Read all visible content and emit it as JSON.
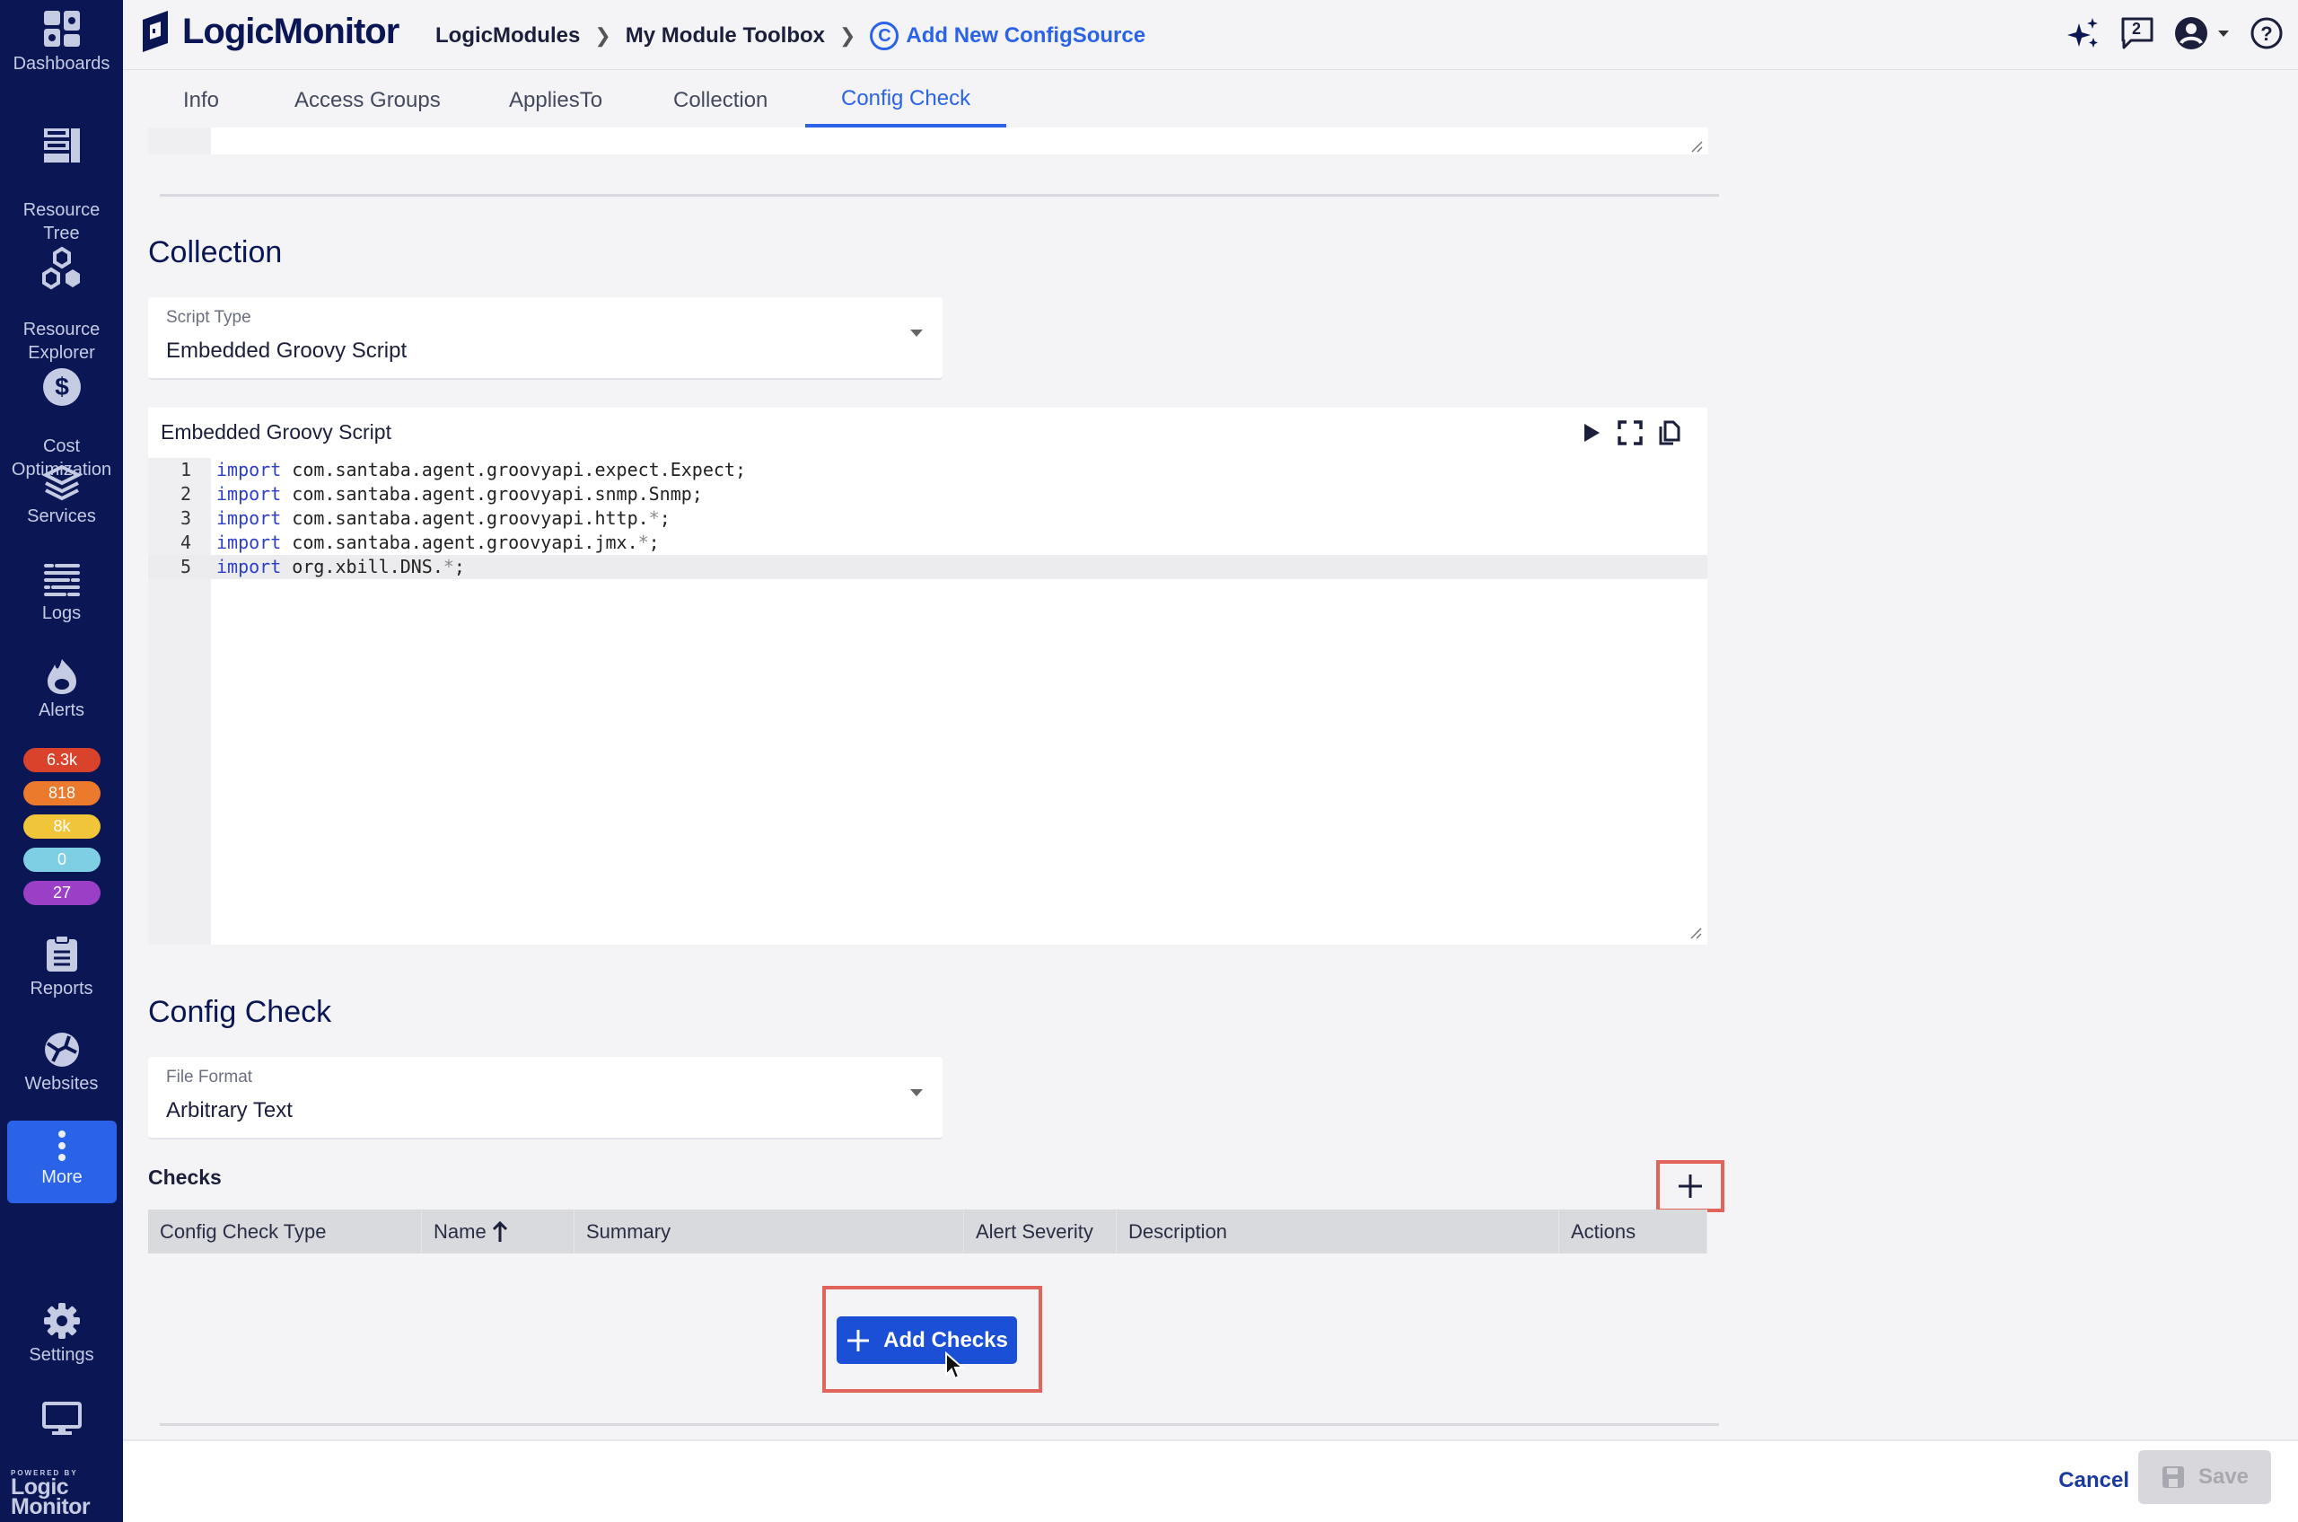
{
  "sidebar": {
    "items": [
      {
        "label": "Dashboards",
        "icon": "dashboards-icon"
      },
      {
        "label": "Resource\nTree",
        "icon": "resource-tree-icon"
      },
      {
        "label": "Resource\nExplorer",
        "icon": "resource-explorer-icon"
      },
      {
        "label": "Cost\nOptimization",
        "icon": "cost-icon"
      },
      {
        "label": "Services",
        "icon": "services-icon"
      },
      {
        "label": "Logs",
        "icon": "logs-icon"
      },
      {
        "label": "Alerts",
        "icon": "alerts-icon"
      },
      {
        "label": "Reports",
        "icon": "reports-icon"
      },
      {
        "label": "Websites",
        "icon": "websites-icon"
      },
      {
        "label": "More",
        "icon": "more-icon",
        "active": true
      },
      {
        "label": "Settings",
        "icon": "gear-icon"
      }
    ],
    "alert_badges": [
      {
        "label": "6.3k",
        "color": "#d9432b"
      },
      {
        "label": "818",
        "color": "#ec7a2c"
      },
      {
        "label": "8k",
        "color": "#f0c53a"
      },
      {
        "label": "0",
        "color": "#7ecfe3"
      },
      {
        "label": "27",
        "color": "#9c3fc7"
      }
    ],
    "powered_by": "POWERED BY",
    "powered_logo_1": "Logic",
    "powered_logo_2": "Monitor"
  },
  "header": {
    "logo": "LogicMonitor",
    "breadcrumbs": [
      "LogicModules",
      "My Module Toolbox",
      "Add New ConfigSource"
    ],
    "current_icon_letter": "C",
    "messages_count": "2"
  },
  "tabs": [
    {
      "label": "Info"
    },
    {
      "label": "Access Groups"
    },
    {
      "label": "AppliesTo"
    },
    {
      "label": "Collection"
    },
    {
      "label": "Config Check",
      "active": true
    }
  ],
  "collection": {
    "title": "Collection",
    "script_type_label": "Script Type",
    "script_type_value": "Embedded Groovy Script",
    "editor_title": "Embedded Groovy Script",
    "code_lines": [
      {
        "n": "1",
        "kw": "import",
        "rest": " com.santaba.agent.groovyapi.expect.Expect;"
      },
      {
        "n": "2",
        "kw": "import",
        "rest": " com.santaba.agent.groovyapi.snmp.Snmp;"
      },
      {
        "n": "3",
        "kw": "import",
        "rest": " com.santaba.agent.groovyapi.http.*;"
      },
      {
        "n": "4",
        "kw": "import",
        "rest": " com.santaba.agent.groovyapi.jmx.*;"
      },
      {
        "n": "5",
        "kw": "import",
        "rest": " org.xbill.DNS.*;"
      }
    ]
  },
  "config_check": {
    "title": "Config Check",
    "file_format_label": "File Format",
    "file_format_value": "Arbitrary Text",
    "checks_label": "Checks",
    "columns": [
      "Config Check Type",
      "Name",
      "Summary",
      "Alert Severity",
      "Description",
      "Actions"
    ],
    "add_checks_label": "Add Checks"
  },
  "footer": {
    "cancel_label": "Cancel",
    "save_label": "Save"
  }
}
